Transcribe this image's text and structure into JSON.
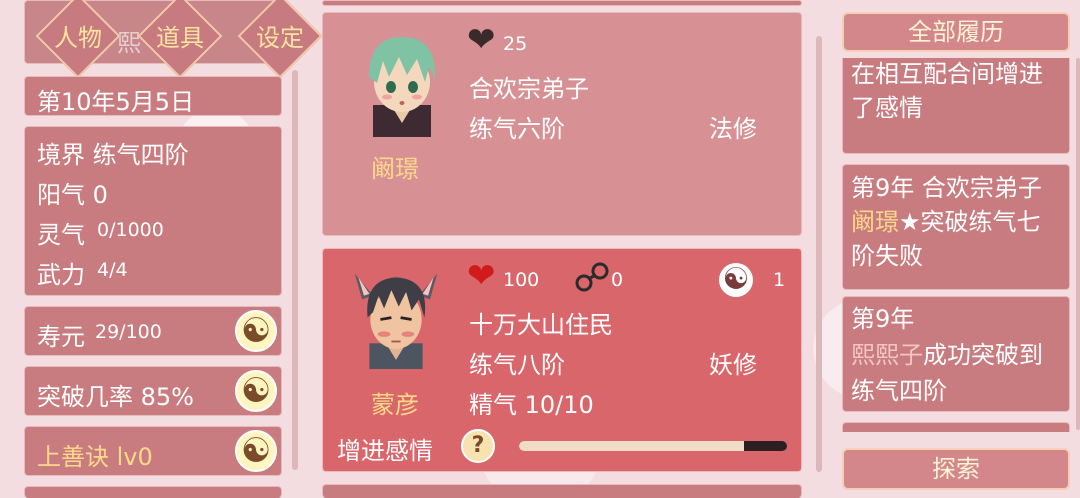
{
  "tabs": [
    {
      "label": "人物"
    },
    {
      "label": "道具"
    },
    {
      "label": "设定"
    }
  ],
  "top_name_fragment": "熙",
  "date": "第10年5月5日",
  "stats": {
    "realm": "境界 练气四阶",
    "yang_label": "阳气 0",
    "spirit_label": "灵气",
    "spirit_value": "0/1000",
    "force_label": "武力",
    "force_value": "4/4"
  },
  "lifespan": {
    "label": "寿元",
    "value": "29/100"
  },
  "breakthrough": {
    "label": "突破几率 85%"
  },
  "skill": {
    "label": "上善诀 lv0"
  },
  "characters": [
    {
      "name": "阚璟",
      "hearts": "25",
      "sect": "合欢宗弟子",
      "level": "练气六阶",
      "class": "法修"
    },
    {
      "name": "蒙彦",
      "hearts": "100",
      "shackles": "0",
      "yinyang_count": "1",
      "origin": "十万大山住民",
      "level": "练气八阶",
      "class": "妖修",
      "essence": "精气 10/10",
      "action_label": "增进感情",
      "progress": 0.84,
      "help_glyph": "?"
    }
  ],
  "history": {
    "title": "全部履历",
    "entries": [
      {
        "prefix": "",
        "highlight": "",
        "text": "在相互配合间增进了感情"
      },
      {
        "prefix": "第9年 合欢宗弟子",
        "highlight": "阚璟",
        "star": "★",
        "text": "突破练气七阶失败"
      },
      {
        "prefix": "第9年",
        "highlight": "熙熙子",
        "text": "成功突破到练气四阶"
      }
    ],
    "explore_label": "探索"
  },
  "icons": {
    "heart": "heart-icon",
    "shackles": "shackles-icon",
    "yinyang": "yinyang-icon",
    "help": "help-icon"
  },
  "colors": {
    "panel": "#c97c80",
    "panel_active": "#d9666b",
    "gold": "#ffd98a",
    "heart_outline": "#3a2b2b",
    "heart_red": "#d11a1a"
  }
}
